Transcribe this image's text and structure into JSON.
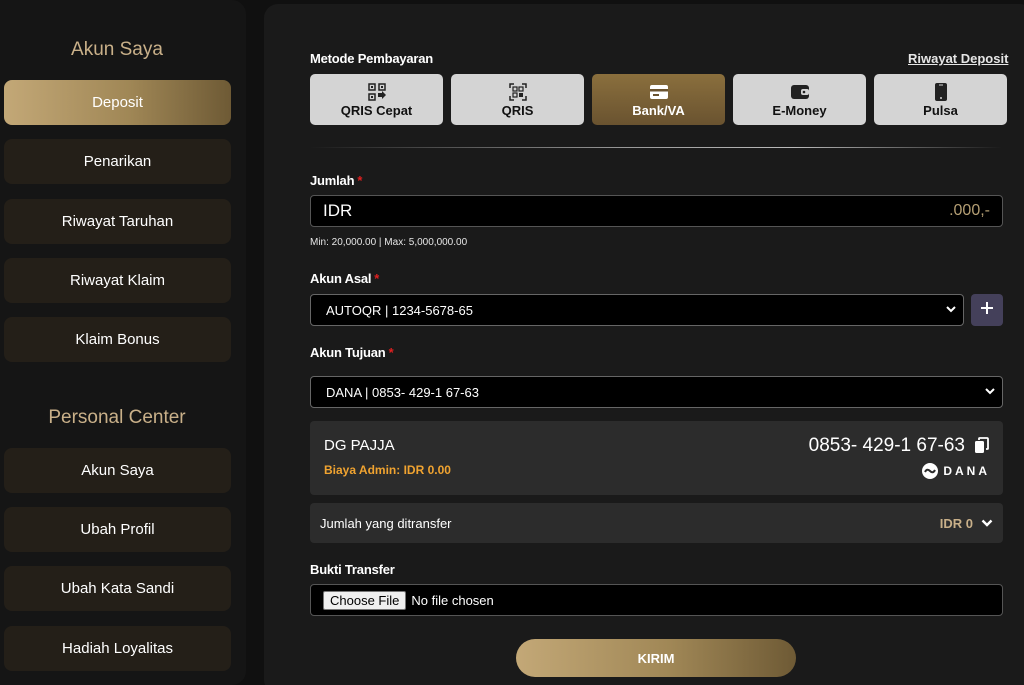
{
  "sidebar": {
    "section1_title": "Akun Saya",
    "section1_items": [
      {
        "label": "Deposit",
        "active": true
      },
      {
        "label": "Penarikan"
      },
      {
        "label": "Riwayat Taruhan"
      },
      {
        "label": "Riwayat Klaim"
      },
      {
        "label": "Klaim Bonus"
      }
    ],
    "section2_title": "Personal Center",
    "section2_items": [
      {
        "label": "Akun Saya"
      },
      {
        "label": "Ubah Profil"
      },
      {
        "label": "Ubah Kata Sandi"
      },
      {
        "label": "Hadiah Loyalitas"
      }
    ]
  },
  "payment": {
    "title": "Metode Pembayaran",
    "history_link": "Riwayat Deposit",
    "methods": [
      {
        "label": "QRIS Cepat",
        "icon": "qr-fast-icon"
      },
      {
        "label": "QRIS",
        "icon": "qr-scan-icon"
      },
      {
        "label": "Bank/VA",
        "icon": "card-icon",
        "active": true
      },
      {
        "label": "E-Money",
        "icon": "wallet-icon"
      },
      {
        "label": "Pulsa",
        "icon": "phone-icon"
      }
    ]
  },
  "amount": {
    "label": "Jumlah",
    "required_mark": "*",
    "prefix": "IDR",
    "suffix": ".000,-",
    "limits": "Min: 20,000.00 | Max: 5,000,000.00"
  },
  "source_account": {
    "label": "Akun Asal",
    "required_mark": "*",
    "selected": "AUTOQR | 1234-5678-65"
  },
  "destination_account": {
    "label": "Akun Tujuan",
    "required_mark": "*",
    "selected": "DANA | 0853- 429-1 67-63",
    "name": "DG PAJJA",
    "admin_fee": "Biaya Admin: IDR 0.00",
    "number": "0853- 429-1 67-63",
    "provider": "DANA"
  },
  "transfer": {
    "label": "Jumlah yang ditransfer",
    "value": "IDR 0"
  },
  "proof": {
    "label": "Bukti Transfer",
    "button": "Choose File",
    "status": "No file chosen"
  },
  "submit_label": "KIRIM",
  "colors": {
    "accent_gold": "#c9b089",
    "admin_fee": "#f0a330",
    "required": "#e02020"
  }
}
